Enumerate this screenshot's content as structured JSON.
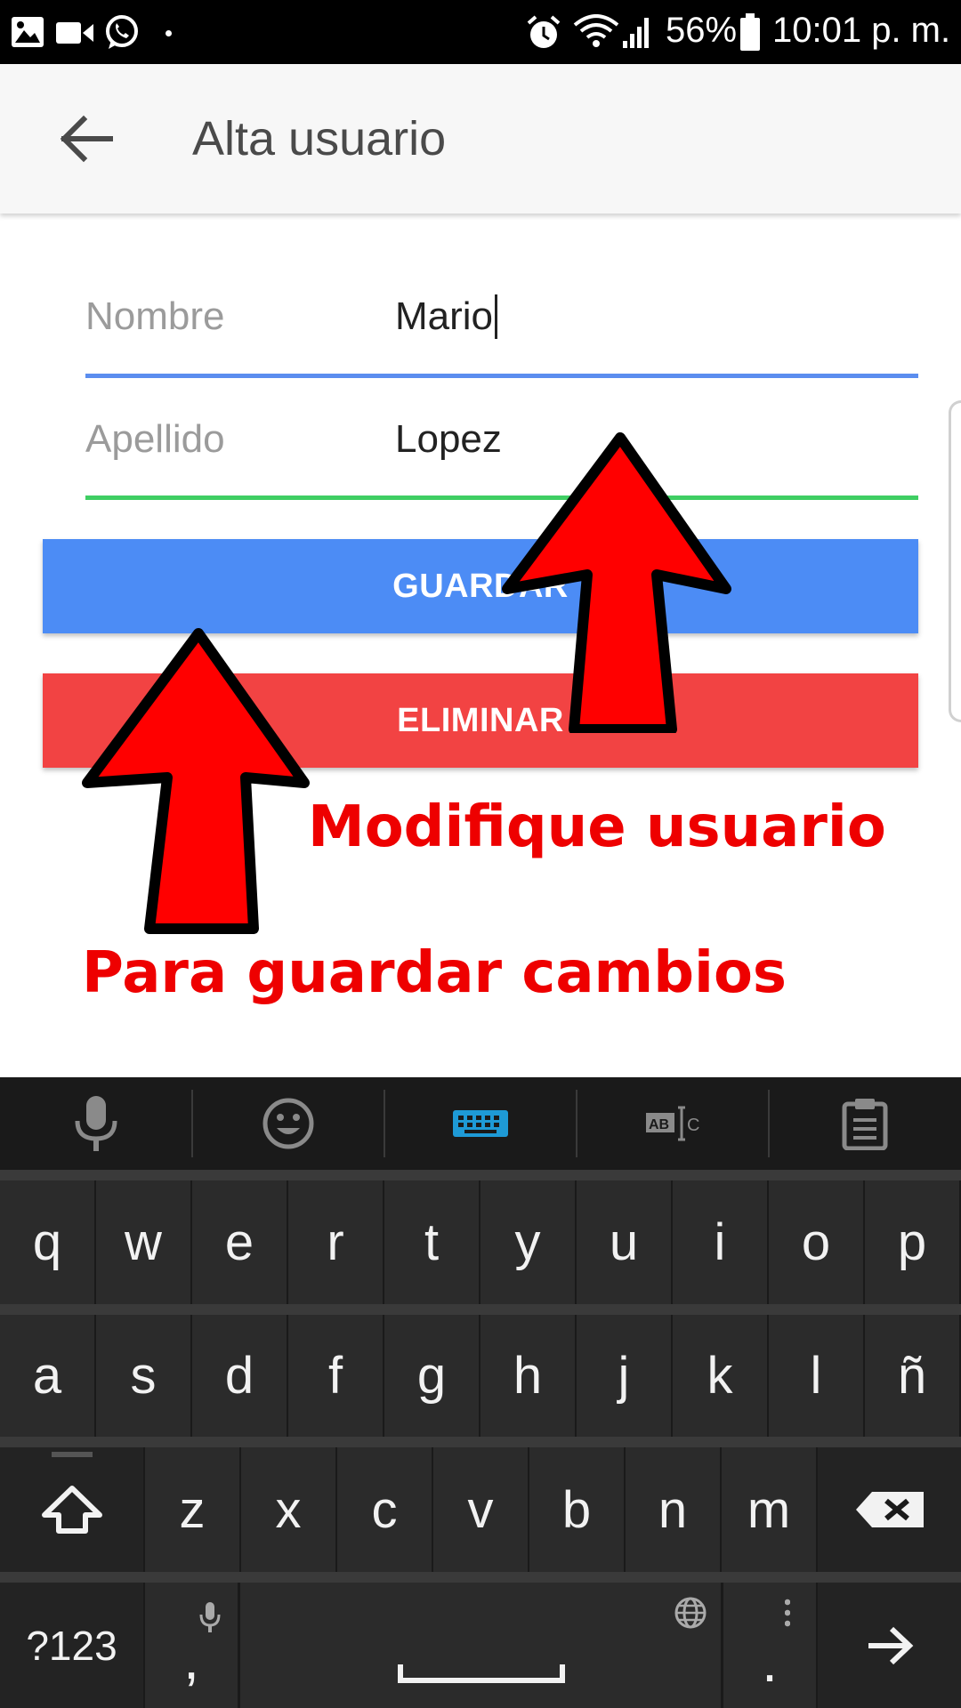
{
  "status_bar": {
    "battery": "56%",
    "time": "10:01 p. m.",
    "icons_left": [
      "image-icon",
      "video-icon",
      "whatsapp-icon",
      "dot-icon"
    ],
    "icons_right": [
      "alarm-icon",
      "wifi-icon",
      "signal-icon",
      "battery-icon"
    ]
  },
  "app_bar": {
    "title": "Alta usuario",
    "back_icon": "arrow-left-icon"
  },
  "form": {
    "nombre_label": "Nombre",
    "nombre_value": "Mario",
    "apellido_label": "Apellido",
    "apellido_value": "Lopez",
    "save_label": "GUARDAR",
    "delete_label": "ELIMINAR",
    "colors": {
      "accent_line": "#5b8def",
      "second_line": "#3fce63",
      "save_button": "#4c8cf5",
      "delete_button": "#f24343"
    }
  },
  "annotations": {
    "modify_text": "Modifique usuario",
    "save_text": "Para guardar cambios",
    "color": "#ee0000"
  },
  "keyboard": {
    "toolbar": [
      "mic-icon",
      "emoji-icon",
      "keyboard-icon",
      "text-edit-icon",
      "clipboard-icon"
    ],
    "row1": [
      "q",
      "w",
      "e",
      "r",
      "t",
      "y",
      "u",
      "i",
      "o",
      "p"
    ],
    "row2": [
      "a",
      "s",
      "d",
      "f",
      "g",
      "h",
      "j",
      "k",
      "l",
      "ñ"
    ],
    "row3": [
      "z",
      "x",
      "c",
      "v",
      "b",
      "n",
      "m"
    ],
    "symbols_label": "?123",
    "comma_label": ",",
    "period_label": "."
  }
}
